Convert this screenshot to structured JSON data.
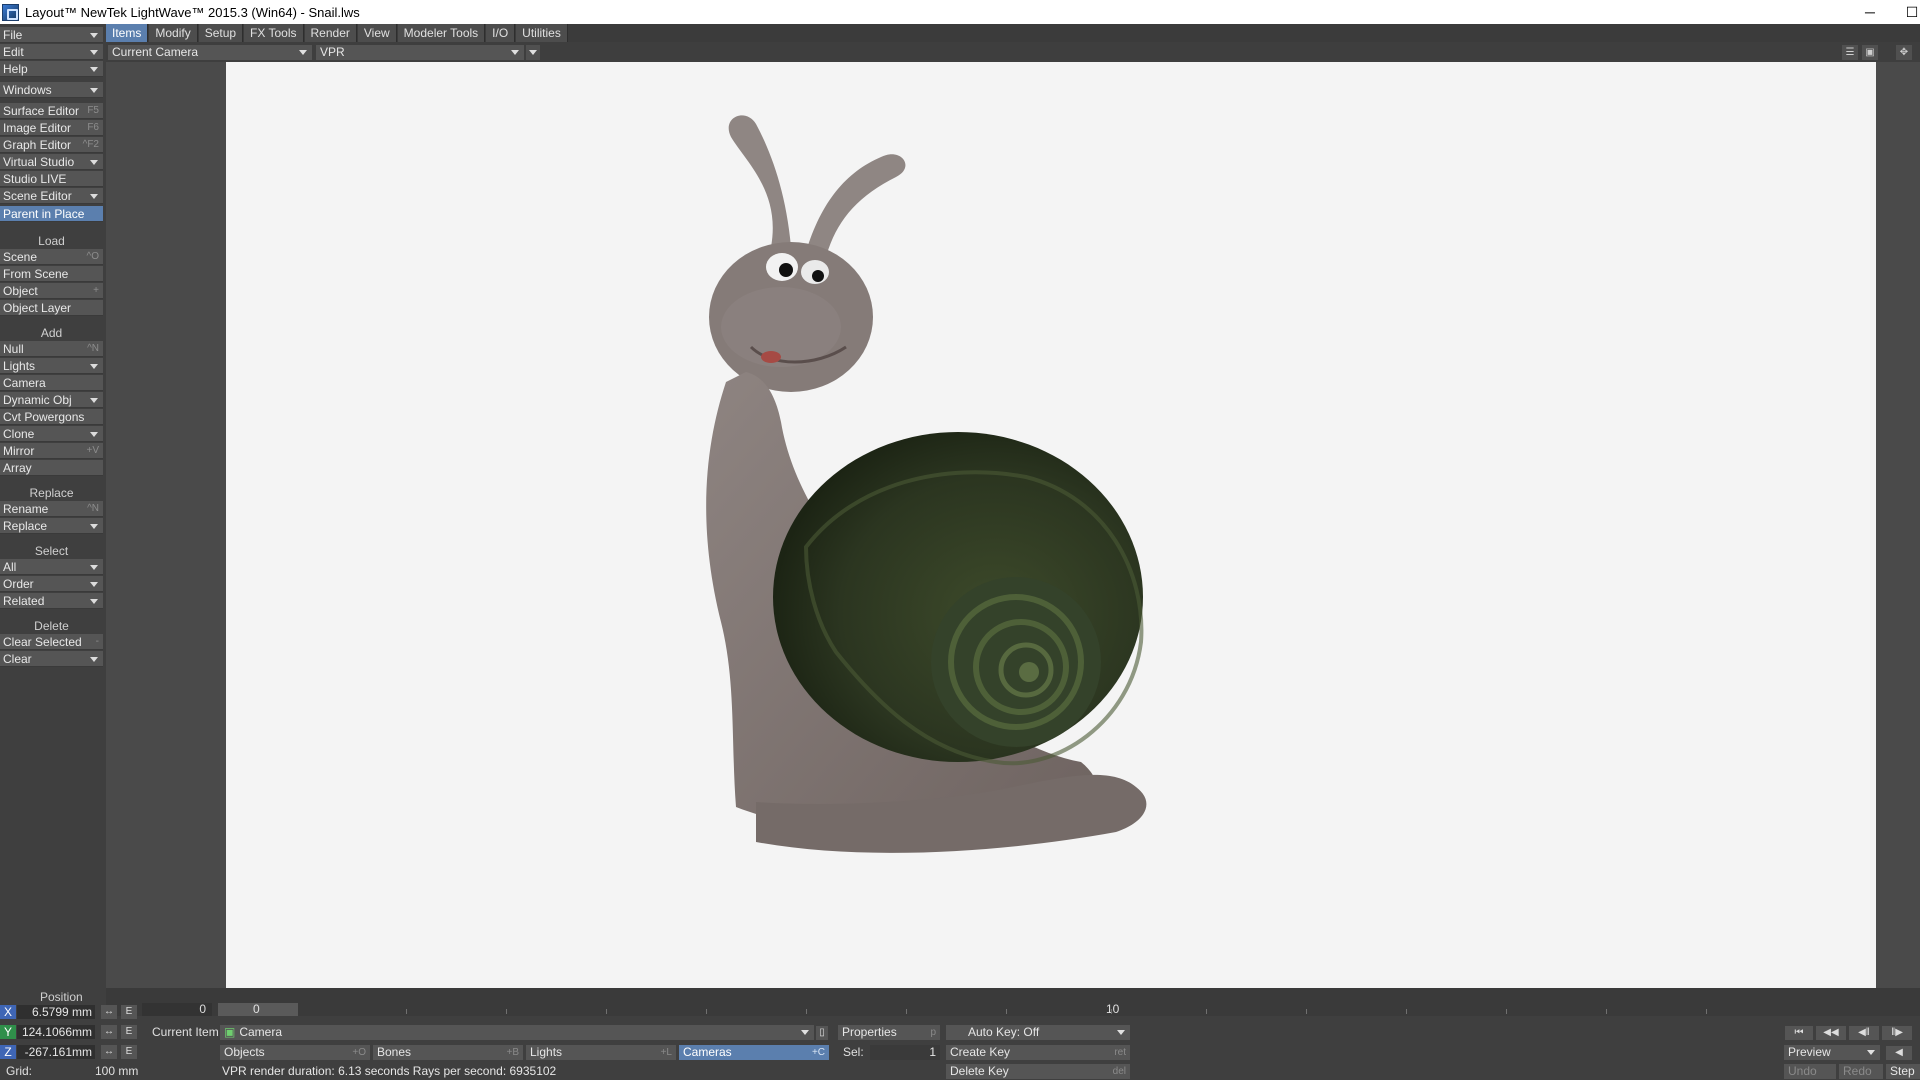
{
  "window": {
    "title": "Layout™ NewTek LightWave™ 2015.3 (Win64) - Snail.lws",
    "minimize": "─",
    "maximize": "☐"
  },
  "left": {
    "menus": [
      {
        "label": "File",
        "dropdown": true
      },
      {
        "label": "Edit",
        "dropdown": true
      },
      {
        "label": "Help",
        "dropdown": true
      }
    ],
    "windows": {
      "label": "Windows"
    },
    "editors": [
      {
        "label": "Surface Editor",
        "shortcut": "F5"
      },
      {
        "label": "Image Editor",
        "shortcut": "F6"
      },
      {
        "label": "Graph Editor",
        "shortcut": "^F2"
      },
      {
        "label": "Virtual Studio",
        "dropdown": true
      },
      {
        "label": "Studio LIVE"
      },
      {
        "label": "Scene Editor",
        "dropdown": true
      }
    ],
    "parent_in_place": "Parent in Place",
    "load": {
      "title": "Load",
      "items": [
        {
          "label": "Scene",
          "shortcut": "^O"
        },
        {
          "label": "From Scene"
        },
        {
          "label": "Object",
          "shortcut": "+"
        },
        {
          "label": "Object Layer"
        }
      ]
    },
    "add": {
      "title": "Add",
      "items": [
        {
          "label": "Null",
          "shortcut": "^N"
        },
        {
          "label": "Lights",
          "dropdown": true
        },
        {
          "label": "Camera"
        },
        {
          "label": "Dynamic Obj",
          "dropdown": true
        },
        {
          "label": "Cvt Powergons"
        },
        {
          "label": "Clone",
          "dropdown": true
        },
        {
          "label": "Mirror",
          "shortcut": "+V"
        },
        {
          "label": "Array"
        }
      ]
    },
    "replace": {
      "title": "Replace",
      "items": [
        {
          "label": "Rename",
          "shortcut": "^N"
        },
        {
          "label": "Replace",
          "dropdown": true
        }
      ]
    },
    "select": {
      "title": "Select",
      "items": [
        {
          "label": "All",
          "dropdown": true
        },
        {
          "label": "Order",
          "dropdown": true
        },
        {
          "label": "Related",
          "dropdown": true
        }
      ]
    },
    "delete": {
      "title": "Delete",
      "items": [
        {
          "label": "Clear Selected",
          "shortcut": "-"
        },
        {
          "label": "Clear",
          "dropdown": true
        }
      ]
    }
  },
  "tabs": [
    "Items",
    "Modify",
    "Setup",
    "FX Tools",
    "Render",
    "View",
    "Modeler Tools",
    "I/O",
    "Utilities"
  ],
  "active_tab": "Items",
  "toolbar": {
    "view": "Current Camera",
    "mode": "VPR"
  },
  "timeline": {
    "start": "0",
    "current": "0",
    "marker_10": "10"
  },
  "position": {
    "title": "Position",
    "x": "6.5799 mm",
    "y": "124.1066mm",
    "z": "-267.161mm",
    "grid_label": "Grid:",
    "grid_value": "100 mm",
    "e": "E"
  },
  "current_item": {
    "label": "Current Item",
    "value": "Camera"
  },
  "categories": [
    {
      "label": "Objects",
      "shortcut": "+O"
    },
    {
      "label": "Bones",
      "shortcut": "+B"
    },
    {
      "label": "Lights",
      "shortcut": "+L"
    },
    {
      "label": "Cameras",
      "shortcut": "+C",
      "active": true
    }
  ],
  "properties": {
    "label": "Properties",
    "shortcut": "p"
  },
  "sel": {
    "label": "Sel:",
    "value": "1"
  },
  "auto_key": "Auto Key: Off",
  "keys": {
    "create": "Create Key",
    "create_sc": "ret",
    "delete": "Delete Key",
    "delete_sc": "del"
  },
  "status": "VPR render duration: 6.13 seconds  Rays per second: 6935102",
  "playback": {
    "preview": "Preview",
    "undo": "Undo",
    "redo": "Redo",
    "step": "Step"
  },
  "colors": {
    "accent": "#5b7fae",
    "panel": "#3f3f3f",
    "button": "#555555",
    "viewport_bg": "#f4f4f4"
  }
}
